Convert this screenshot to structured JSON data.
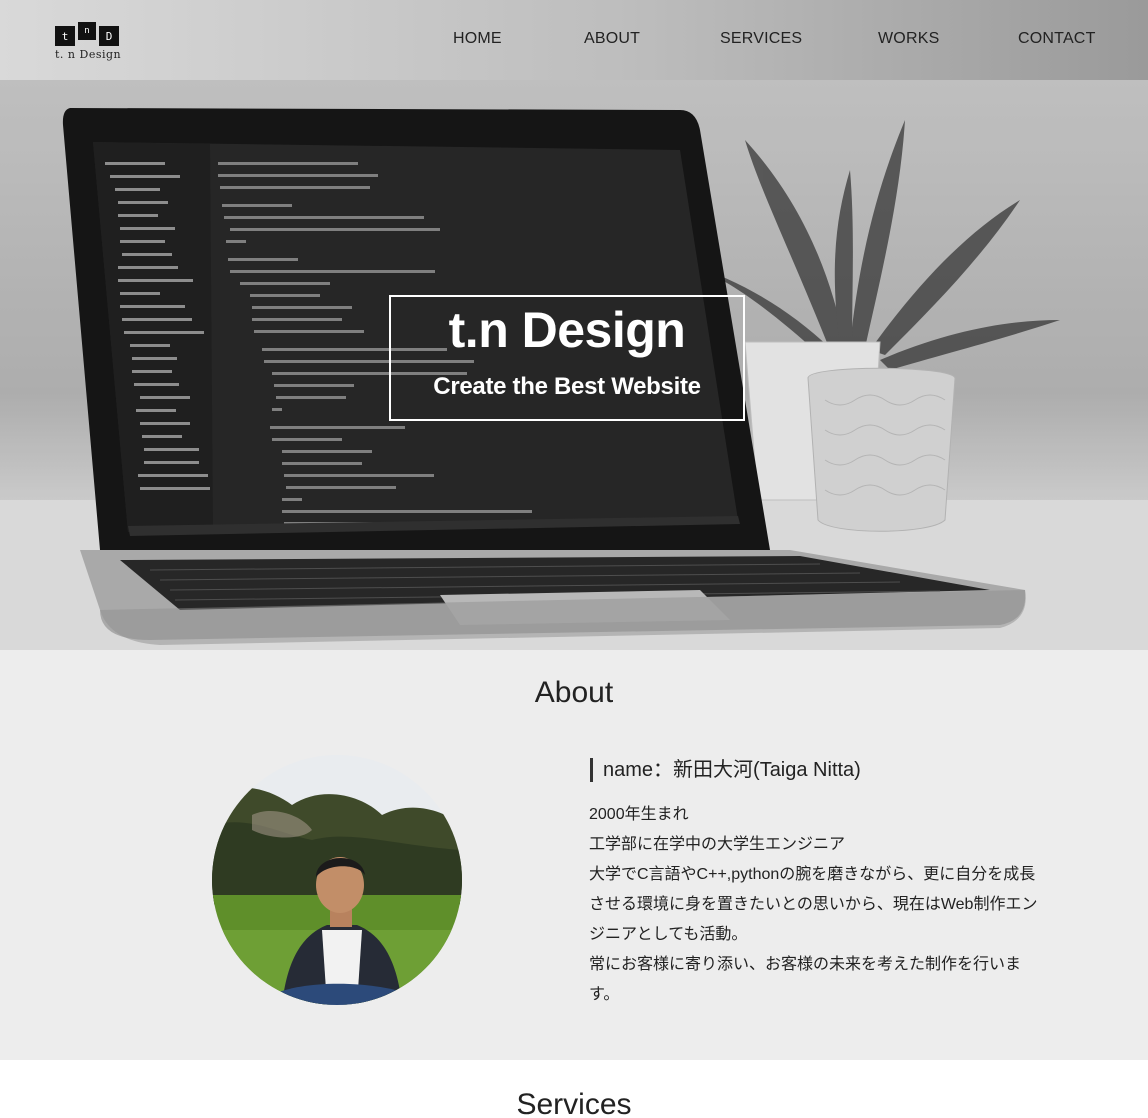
{
  "brand": {
    "logo_letters": [
      "t",
      "n",
      "D"
    ],
    "logo_text": "t. n Design"
  },
  "nav": {
    "items": [
      {
        "label": "HOME"
      },
      {
        "label": "ABOUT"
      },
      {
        "label": "SERVICES"
      },
      {
        "label": "WORKS"
      },
      {
        "label": "CONTACT"
      }
    ]
  },
  "hero": {
    "title": "t.n Design",
    "subtitle": "Create the Best Website"
  },
  "about": {
    "heading": "About",
    "name": "name：新田大河(Taiga Nitta)",
    "lines": [
      "2000年生まれ",
      "工学部に在学中の大学生エンジニア",
      "大学でC言語やC++,pythonの腕を磨きながら、更に自分を成長させる環境に身を置きたいとの思いから、現在はWeb制作エンジニアとしても活動。",
      "常にお客様に寄り添い、お客様の未来を考えた制作を行います。"
    ]
  },
  "services": {
    "heading": "Services"
  },
  "colors": {
    "header_bg": "#c4c4c4",
    "about_bg": "#ededed",
    "text": "#222222",
    "hero_text": "#ffffff"
  }
}
